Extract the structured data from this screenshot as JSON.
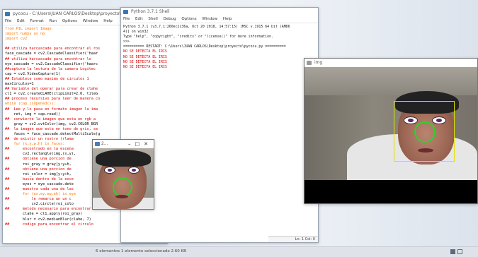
{
  "editor": {
    "title": "pycocu - C:\\Users\\JUAN CARLOS\\Desktop\\proyecto\\pycocu.py (3.7.1)",
    "menu": [
      "File",
      "Edit",
      "Format",
      "Run",
      "Options",
      "Window",
      "Help"
    ],
    "lines": [
      {
        "cls": "kw",
        "t": "from PIL import Image"
      },
      {
        "cls": "kw",
        "t": "import numpy as np"
      },
      {
        "cls": "kw",
        "t": "import cv2"
      },
      {
        "cls": "",
        "t": ""
      },
      {
        "cls": "cm",
        "t": "## utiliza harcascade para encontrar el ros"
      },
      {
        "cls": "",
        "t": "face_cascade = cv2.CascadeClassifier('haar"
      },
      {
        "cls": "cm",
        "t": "## utiliza harcascade para encontrar lo"
      },
      {
        "cls": "",
        "t": "eye_cascade = cv2.CascadeClassifier('haarc"
      },
      {
        "cls": "cm",
        "t": "##captura la lectura de la camara Logitec"
      },
      {
        "cls": "",
        "t": "cap = cv2.VideoCapture(1)"
      },
      {
        "cls": "cm",
        "t": "## Establece como maximo de circulos 1"
      },
      {
        "cls": "",
        "t": "maxCirculos=1"
      },
      {
        "cls": "cm",
        "t": "## Variable del operar para crear de clahe"
      },
      {
        "cls": "",
        "t": "cl1 = cv2.createCLAHE(clipLimit=2.0, tileG"
      },
      {
        "cls": "cm",
        "t": "## proceso recursivo para leer de manera co"
      },
      {
        "cls": "kw",
        "t": "while (cap.isOpened()):"
      },
      {
        "cls": "cm",
        "t": "##  Lee y lo pasa en formato imagen la ima"
      },
      {
        "cls": "",
        "t": "    ret, img = cap.read()"
      },
      {
        "cls": "cm",
        "t": "##  convierte la imagen que esta en rgb a"
      },
      {
        "cls": "",
        "t": "    gray = cv2.cvtColor(img, cv2.COLOR_BGR"
      },
      {
        "cls": "cm",
        "t": "##  la imagen que esta en tono de gris, se"
      },
      {
        "cls": "",
        "t": "    faces = face_cascade.detectMultiScale(g"
      },
      {
        "cls": "cm",
        "t": "##  de existir un rostro (rlama"
      },
      {
        "cls": "kw",
        "t": "    for (x,y,w,h) in faces:"
      },
      {
        "cls": "cm",
        "t": "##      encontrado en la escena"
      },
      {
        "cls": "",
        "t": "        cv2.rectangle(img,(x,y),"
      },
      {
        "cls": "cm",
        "t": "##      obtiene una porcion de"
      },
      {
        "cls": "",
        "t": "        roi_gray = gray[y:y+h,"
      },
      {
        "cls": "cm",
        "t": "##      obtiene una porcion de"
      },
      {
        "cls": "",
        "t": "        roi_color = img[y:y+h,"
      },
      {
        "cls": "cm",
        "t": "##      busca dentro de la esce"
      },
      {
        "cls": "",
        "t": "        eyes = eye_cascade.dete"
      },
      {
        "cls": "cm",
        "t": "##      muestra cada una de las"
      },
      {
        "cls": "kw",
        "t": "        for (ex,ey,ew,eh) in eye"
      },
      {
        "cls": "cm",
        "t": "##          le remarca un un c"
      },
      {
        "cls": "",
        "t": "            cv2.circle(roi_colo"
      },
      {
        "cls": "cm",
        "t": "##      metodo necesario para encontrar e"
      },
      {
        "cls": "",
        "t": "        clahe = cl1.apply(roi_gray)"
      },
      {
        "cls": "",
        "t": "        blur = cv2.medianBlur(clahe, 7)"
      },
      {
        "cls": "cm",
        "t": "##      codigo para encontrar el circulo"
      }
    ]
  },
  "shell": {
    "title": "Python 3.7.1 Shell",
    "menu": [
      "File",
      "Edit",
      "Shell",
      "Debug",
      "Options",
      "Window",
      "Help"
    ],
    "lines": [
      {
        "cls": "plain",
        "t": "Python 3.7.1 (v3.7.1:260ec2c36a, Oct 20 2018, 14:57:15) [MSC v.1915 64 bit (AMD6"
      },
      {
        "cls": "plain",
        "t": "4)] on win32"
      },
      {
        "cls": "plain",
        "t": "Type \"help\", \"copyright\", \"credits\" or \"license()\" for more information."
      },
      {
        "cls": "plain",
        "t": ">>>"
      },
      {
        "cls": "plain",
        "t": "========== RESTART: C:\\Users\\JUAN CARLOS\\Desktop\\proyecto\\pycocu.py =========="
      },
      {
        "cls": "out",
        "t": "NO SE DETECTA EL IRIS"
      },
      {
        "cls": "out",
        "t": "NO SE DETECTA EL IRIS"
      },
      {
        "cls": "out",
        "t": "NO SE DETECTA EL IRIS"
      },
      {
        "cls": "out",
        "t": "NO SE DETECTA EL IRIS"
      }
    ],
    "status": "Ln: 1  Col: 0"
  },
  "img_window": {
    "title": "img"
  },
  "small_window": {
    "title": "2..."
  },
  "taskbar": {
    "items": "6 elementos    1 elemento seleccionado  2.60 KB"
  }
}
